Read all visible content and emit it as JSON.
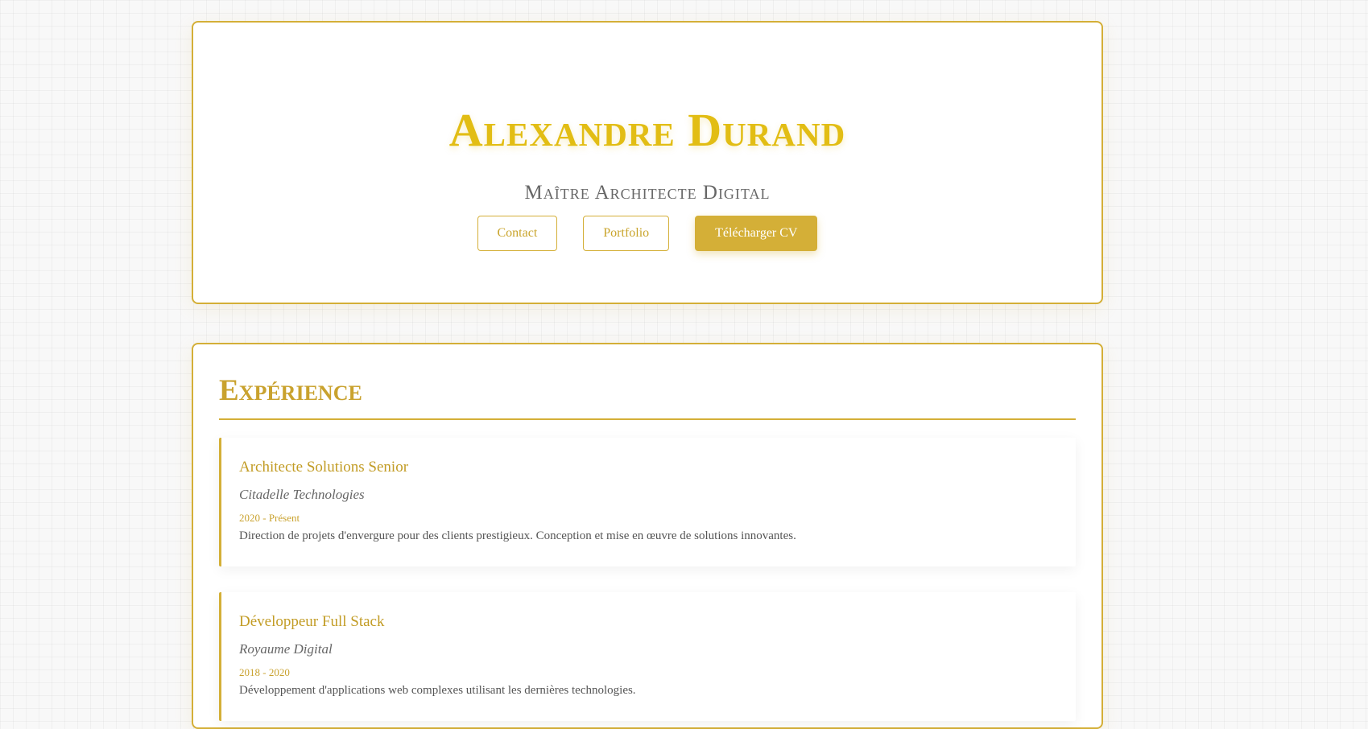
{
  "hero": {
    "name": "Alexandre Durand",
    "title": "Maître Architecte Digital",
    "buttons": {
      "contact": "Contact",
      "portfolio": "Portfolio",
      "download": "Télécharger CV"
    }
  },
  "experience": {
    "heading": "Expérience",
    "jobs": [
      {
        "title": "Architecte Solutions Senior",
        "company": "Citadelle Technologies",
        "dates": "2020 - Présent",
        "description": "Direction de projets d'envergure pour des clients prestigieux. Conception et mise en œuvre de solutions innovantes."
      },
      {
        "title": "Développeur Full Stack",
        "company": "Royaume Digital",
        "dates": "2018 - 2020",
        "description": "Développement d'applications web complexes utilisant les dernières technologies."
      }
    ]
  },
  "colors": {
    "accent": "#d4af37",
    "name_gold": "#e2bd14"
  }
}
